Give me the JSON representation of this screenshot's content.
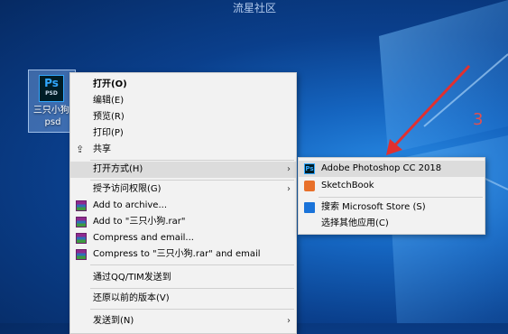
{
  "watermark": "流星社区",
  "annotation_number": "3",
  "desktop_icon": {
    "label_line1": "三只小狗.",
    "label_line2": "psd",
    "tile_text": "Ps",
    "tile_sub": "PSD"
  },
  "context_menu": {
    "items": [
      {
        "label": "打开(O)"
      },
      {
        "label": "编辑(E)"
      },
      {
        "label": "预览(R)"
      },
      {
        "label": "打印(P)"
      },
      {
        "label": "共享"
      },
      {
        "label": "打开方式(H)"
      },
      {
        "label": "授予访问权限(G)"
      },
      {
        "label": "Add to archive..."
      },
      {
        "label": "Add to \"三只小狗.rar\""
      },
      {
        "label": "Compress and email..."
      },
      {
        "label": "Compress to \"三只小狗.rar\" and email"
      },
      {
        "label": "通过QQ/TIM发送到"
      },
      {
        "label": "还原以前的版本(V)"
      },
      {
        "label": "发送到(N)"
      }
    ]
  },
  "submenu": {
    "items": [
      {
        "label": "Adobe Photoshop CC 2018"
      },
      {
        "label": "SketchBook"
      },
      {
        "label": "搜索 Microsoft Store (S)"
      },
      {
        "label": "选择其他应用(C)"
      }
    ]
  },
  "colors": {
    "highlight": "#dcdcdc",
    "menu_bg": "#f2f2f2",
    "annotation_red": "#e05050"
  }
}
